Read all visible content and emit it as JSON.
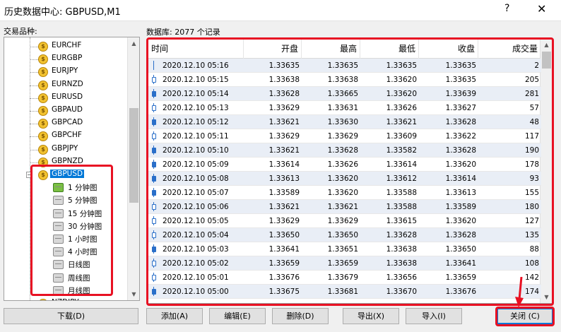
{
  "window": {
    "title": "历史数据中心: GBPUSD,M1",
    "help_glyph": "?",
    "close_glyph": "✕"
  },
  "symbols_label": "交易品种:",
  "database_label": "数据库: 2077 个记录",
  "tree": {
    "symbols": [
      "EURCHF",
      "EURGBP",
      "EURJPY",
      "EURNZD",
      "EURUSD",
      "GBPAUD",
      "GBPCAD",
      "GBPCHF",
      "GBPJPY",
      "GBPNZD"
    ],
    "selected": "GBPUSD",
    "timeframes": [
      "1 分钟图",
      "5 分钟图",
      "15 分钟图",
      "30 分钟图",
      "1 小时图",
      "4 小时图",
      "日线图",
      "周线图",
      "月线图"
    ],
    "next_partial": "NZDJPY",
    "coin_glyph": "$",
    "expander_glyph": "−"
  },
  "table": {
    "headers": [
      "时间",
      "开盘",
      "最高",
      "最低",
      "收盘",
      "成交量"
    ],
    "rows": [
      [
        "2020.12.10 05:16",
        "1.33635",
        "1.33635",
        "1.33635",
        "1.33635",
        "2"
      ],
      [
        "2020.12.10 05:15",
        "1.33638",
        "1.33638",
        "1.33620",
        "1.33635",
        "205"
      ],
      [
        "2020.12.10 05:14",
        "1.33628",
        "1.33665",
        "1.33620",
        "1.33639",
        "281"
      ],
      [
        "2020.12.10 05:13",
        "1.33629",
        "1.33631",
        "1.33626",
        "1.33627",
        "57"
      ],
      [
        "2020.12.10 05:12",
        "1.33621",
        "1.33630",
        "1.33621",
        "1.33628",
        "48"
      ],
      [
        "2020.12.10 05:11",
        "1.33629",
        "1.33629",
        "1.33609",
        "1.33622",
        "117"
      ],
      [
        "2020.12.10 05:10",
        "1.33621",
        "1.33628",
        "1.33582",
        "1.33628",
        "190"
      ],
      [
        "2020.12.10 05:09",
        "1.33614",
        "1.33626",
        "1.33614",
        "1.33620",
        "178"
      ],
      [
        "2020.12.10 05:08",
        "1.33613",
        "1.33620",
        "1.33612",
        "1.33614",
        "93"
      ],
      [
        "2020.12.10 05:07",
        "1.33589",
        "1.33620",
        "1.33588",
        "1.33613",
        "155"
      ],
      [
        "2020.12.10 05:06",
        "1.33621",
        "1.33621",
        "1.33588",
        "1.33589",
        "180"
      ],
      [
        "2020.12.10 05:05",
        "1.33629",
        "1.33629",
        "1.33615",
        "1.33620",
        "127"
      ],
      [
        "2020.12.10 05:04",
        "1.33650",
        "1.33650",
        "1.33628",
        "1.33628",
        "135"
      ],
      [
        "2020.12.10 05:03",
        "1.33641",
        "1.33651",
        "1.33638",
        "1.33650",
        "88"
      ],
      [
        "2020.12.10 05:02",
        "1.33659",
        "1.33659",
        "1.33638",
        "1.33641",
        "108"
      ],
      [
        "2020.12.10 05:01",
        "1.33676",
        "1.33679",
        "1.33656",
        "1.33659",
        "142"
      ],
      [
        "2020.12.10 05:00",
        "1.33675",
        "1.33681",
        "1.33670",
        "1.33676",
        "174"
      ]
    ],
    "scroll_up": "▲",
    "scroll_down": "▼"
  },
  "buttons": {
    "download": "下载(D)",
    "add": "添加(A)",
    "edit": "编辑(E)",
    "delete": "删除(D)",
    "export": "导出(X)",
    "import": "导入(I)",
    "close": "关闭 (C)"
  },
  "colors": {
    "highlight": "#e81123",
    "selection": "#0078d7",
    "alt_row": "#e9eef6"
  }
}
